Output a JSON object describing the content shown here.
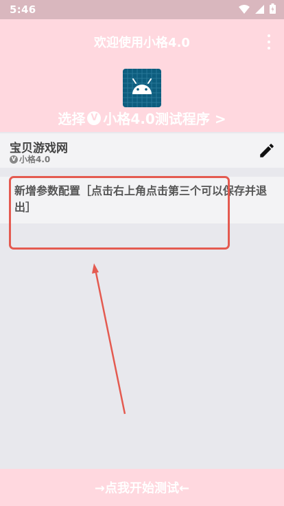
{
  "status_bar": {
    "time": "5:46"
  },
  "header": {
    "title": "欢迎使用小格4.0",
    "select_label": "选择",
    "select_app": "小格4.0测试程序 >",
    "badge": "V"
  },
  "project": {
    "name": "宝贝游戏网",
    "subtitle": "小格4.0",
    "badge": "V"
  },
  "config_item": {
    "text": "新增参数配置［点击右上角点击第三个可以保存并退出］"
  },
  "bottom": {
    "start_label": "→点我开始测试←"
  },
  "colors": {
    "header_bg": "#ffd8df",
    "status_bg": "#d9b7be",
    "annotation": "#e45a50",
    "icon_bg": "#0d5d7e",
    "android_green": "#ffffff"
  },
  "icons": [
    "wifi-icon",
    "signal-icon",
    "battery-icon",
    "more-vert-icon",
    "android-icon",
    "edit-icon"
  ]
}
